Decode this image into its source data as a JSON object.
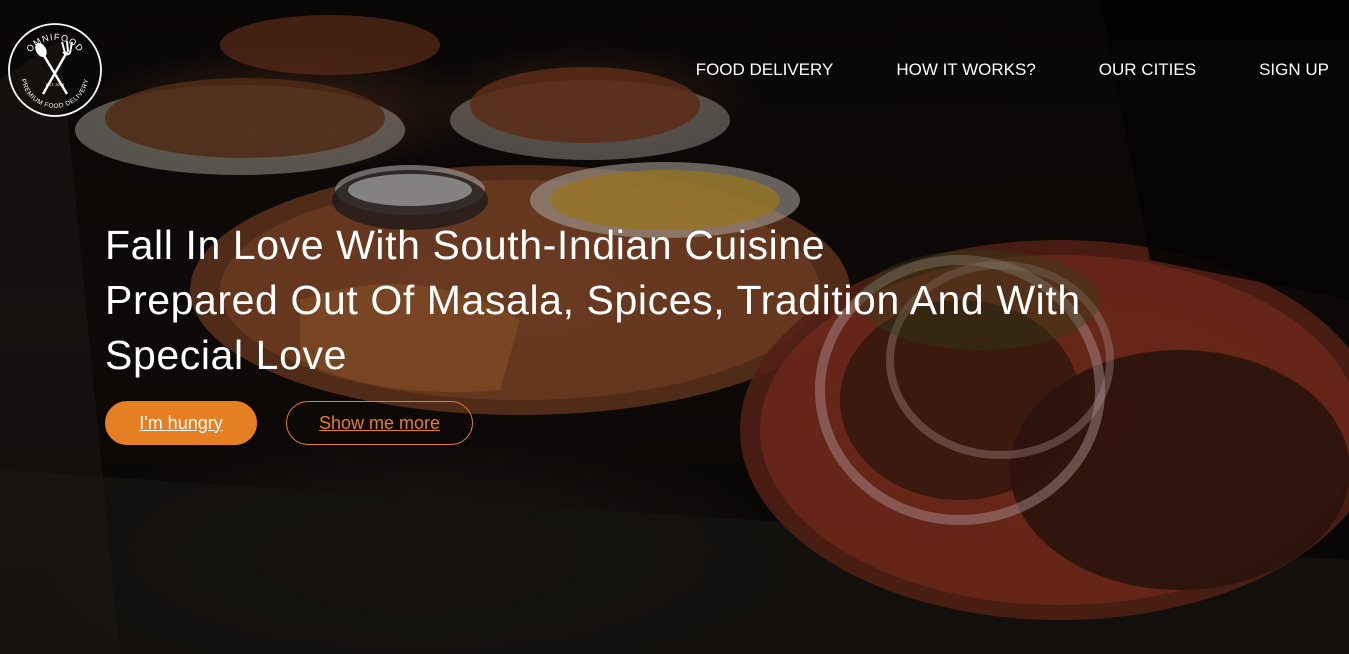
{
  "logo": {
    "brand": "OMNIFOOD",
    "tagline": "PREMIUM FOOD DELIVERY",
    "est": "EST. 2015"
  },
  "nav": {
    "items": [
      "FOOD DELIVERY",
      "HOW IT WORKS?",
      "OUR CITIES",
      "SIGN UP"
    ]
  },
  "hero": {
    "headline_lines": [
      "Fall In Love With South-Indian Cuisine",
      "Prepared Out Of Masala, Spices, Tradition And With",
      "Special Love"
    ],
    "primary_button": "I'm hungry",
    "secondary_button": "Show me more"
  },
  "colors": {
    "accent": "#e67e22",
    "text": "#ffffff"
  }
}
